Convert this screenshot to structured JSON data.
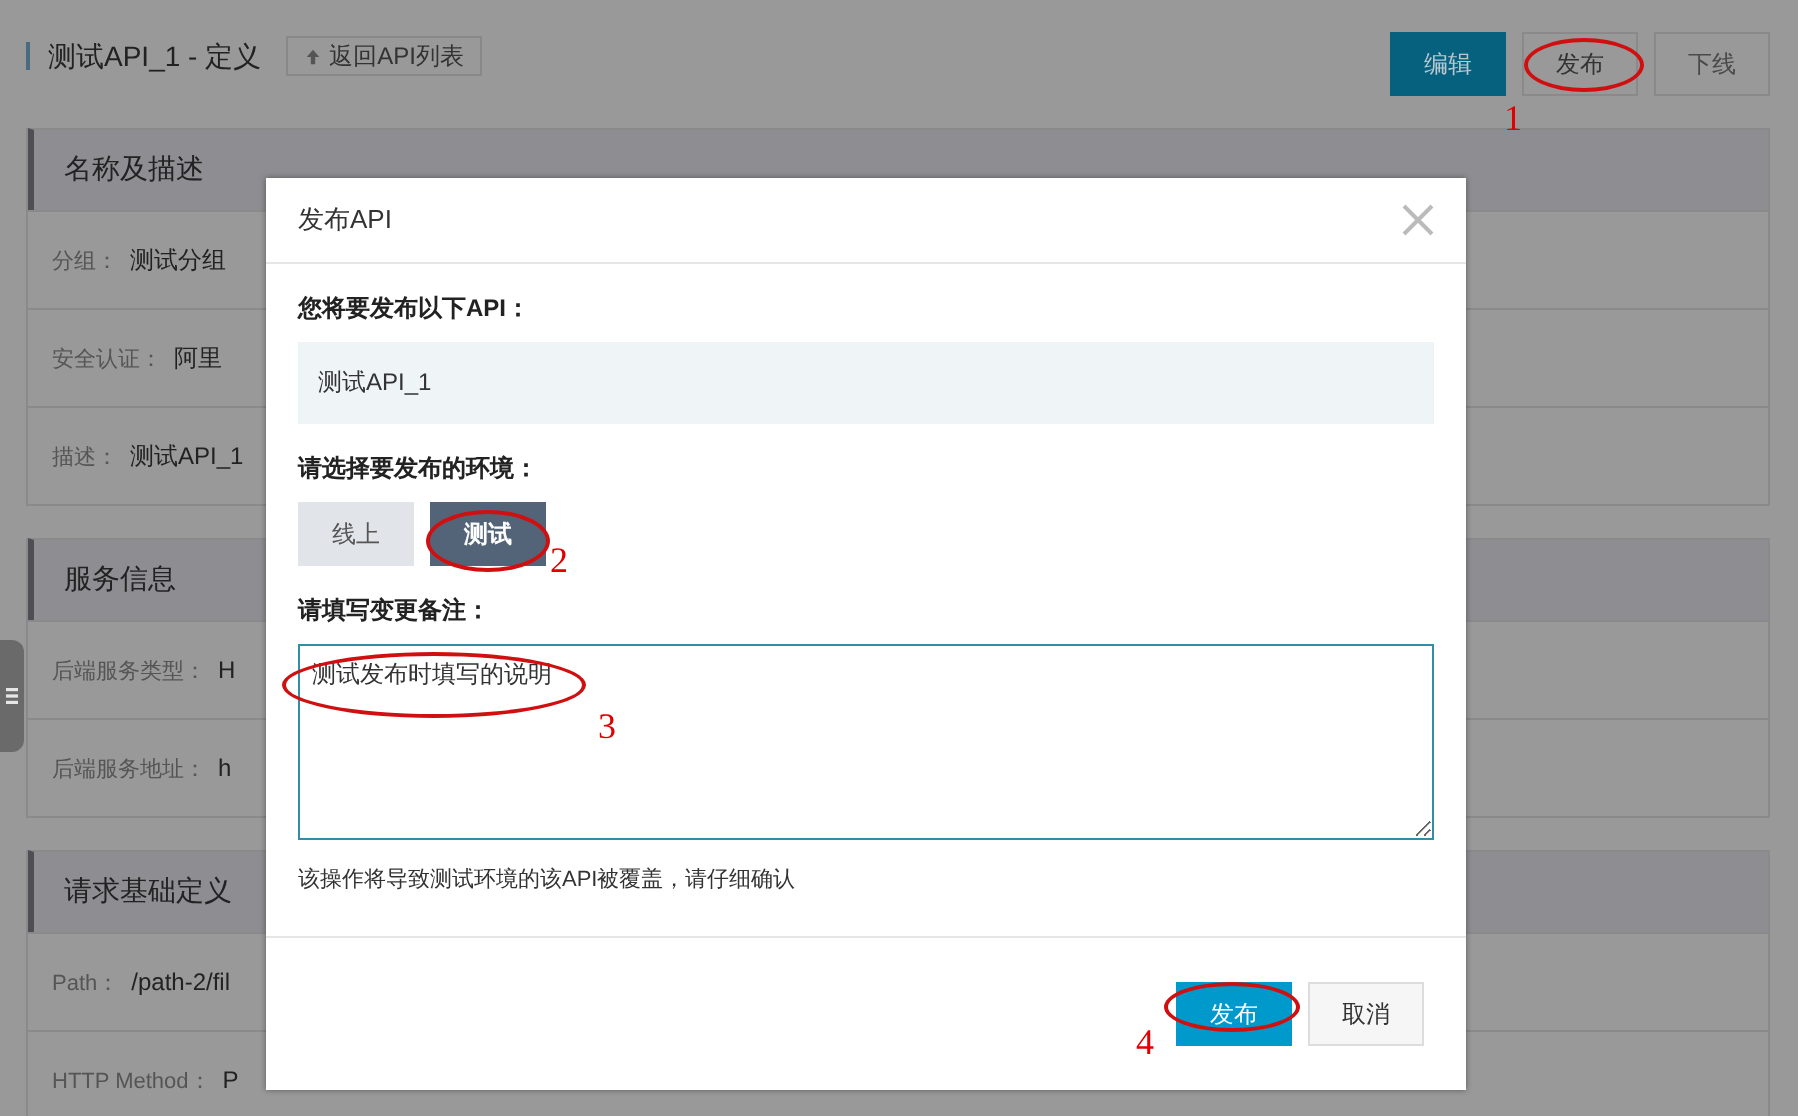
{
  "header": {
    "title": "测试API_1 - 定义",
    "back_button": "返回API列表"
  },
  "actions": [
    {
      "label": "编辑",
      "kind": "primary"
    },
    {
      "label": "发布",
      "kind": "default"
    },
    {
      "label": "下线",
      "kind": "disabled"
    }
  ],
  "sections": [
    {
      "title": "名称及描述",
      "fields": [
        {
          "label": "分组：",
          "value": "测试分组"
        },
        {
          "label": "安全认证：",
          "value": "阿里"
        },
        {
          "label": "描述：",
          "value": "测试API_1"
        }
      ]
    },
    {
      "title": "服务信息",
      "fields": [
        {
          "label": "后端服务类型：",
          "value": "H"
        },
        {
          "label": "后端服务地址：",
          "value": "h"
        }
      ]
    },
    {
      "title": "请求基础定义",
      "fields": [
        {
          "label": "Path：",
          "value": "/path-2/fil"
        },
        {
          "label": "HTTP Method：",
          "value": "P"
        }
      ]
    }
  ],
  "modal": {
    "title": "发布API",
    "api_label": "您将要发布以下API：",
    "api_name": "测试API_1",
    "env_label": "请选择要发布的环境：",
    "environments": [
      {
        "label": "线上",
        "selected": false
      },
      {
        "label": "测试",
        "selected": true
      }
    ],
    "remark_label": "请填写变更备注：",
    "remark_value": "测试发布时填写的说明",
    "hint": "该操作将导致测试环境的该API被覆盖，请仔细确认",
    "buttons": [
      {
        "label": "发布",
        "kind": "primary"
      },
      {
        "label": "取消",
        "kind": "default"
      }
    ]
  },
  "annotations": [
    {
      "number": "1"
    },
    {
      "number": "2"
    },
    {
      "number": "3"
    },
    {
      "number": "4"
    }
  ]
}
